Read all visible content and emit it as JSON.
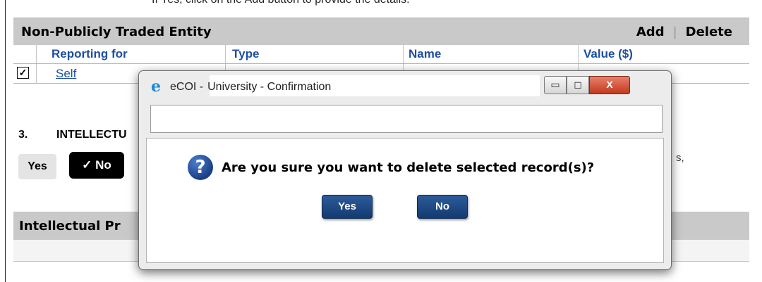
{
  "page": {
    "clipped_note": "If Yes, click on the Add button to provide the details.",
    "section1": {
      "title": "Non-Publicly Traded Entity",
      "add_label": "Add",
      "separator": "|",
      "delete_label": "Delete",
      "columns": [
        "Reporting for",
        "Type",
        "Name",
        "Value ($)"
      ],
      "rows": [
        {
          "checked": true,
          "check_mark": "✓",
          "reporting_for": "Self"
        }
      ]
    },
    "question3": {
      "number": "3.",
      "text": "INTELLECTU",
      "yes_label": "Yes",
      "no_label": "✓ No",
      "right_fragment": "s,"
    },
    "section2": {
      "title": "Intellectual Pr"
    }
  },
  "dialog": {
    "app_name": "eCOI -",
    "title": "University - Confirmation",
    "minimize_glyph": "▭",
    "maximize_glyph": "◻",
    "close_glyph": "X",
    "message": "Are you sure you want to delete selected record(s)?",
    "question_glyph": "?",
    "yes_label": "Yes",
    "no_label": "No",
    "icon": "question-mark-icon"
  },
  "colors": {
    "header_bar": "#c9c9c9",
    "link_blue": "#1d4fa0",
    "dialog_button": "#1b477f",
    "close_button": "#c84a2f"
  }
}
